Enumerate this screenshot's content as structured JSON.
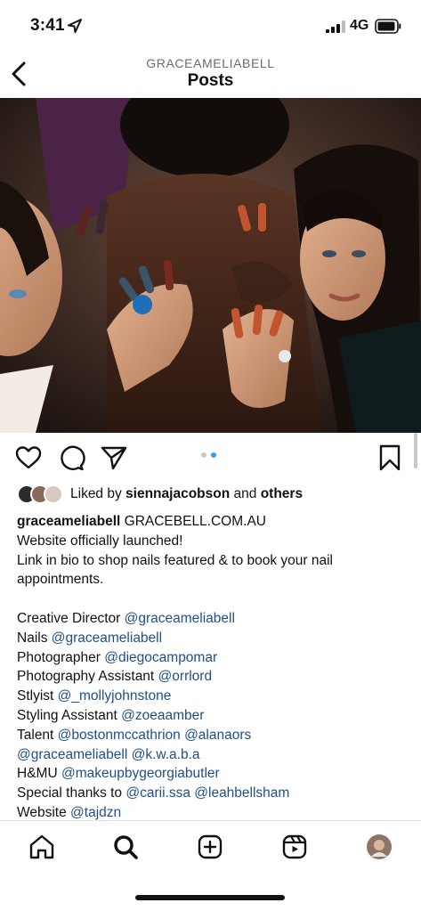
{
  "status_bar": {
    "time": "3:41",
    "network": "4G",
    "icons": [
      "location-arrow-icon",
      "signal-bars-icon",
      "battery-icon"
    ]
  },
  "header": {
    "username": "GRACEAMELIABELL",
    "title": "Posts",
    "back_icon": "chevron-left-icon"
  },
  "post": {
    "image_icon": "photo",
    "actions": [
      "heart-icon",
      "comment-icon",
      "share-icon",
      "bookmark-icon"
    ],
    "carousel": {
      "count": 2,
      "active": 2
    },
    "likes": {
      "prefix": "Liked by",
      "user": "siennajacobson",
      "and": "and",
      "others": "others"
    },
    "caption": {
      "username": "graceameliabell",
      "first_line": "GRACEBELL.COM.AU",
      "lines": [
        "Website officially launched!",
        "Link in bio to shop nails featured & to book your nail",
        "appointments."
      ],
      "credits": [
        {
          "label": "Creative Director ",
          "mentions": [
            "@graceameliabell"
          ]
        },
        {
          "label": "Nails ",
          "mentions": [
            "@graceameliabell"
          ]
        },
        {
          "label": "Photographer ",
          "mentions": [
            "@diegocampomar"
          ]
        },
        {
          "label": "Photography Assistant ",
          "mentions": [
            "@orrlord"
          ]
        },
        {
          "label": "Stlyist ",
          "mentions": [
            "@_mollyjohnstone"
          ]
        },
        {
          "label": "Styling Assistant ",
          "mentions": [
            "@zoeaamber"
          ]
        },
        {
          "label": "Talent ",
          "mentions": [
            "@bostonmccathrion",
            "@alanaors"
          ]
        },
        {
          "label": "",
          "mentions": [
            "@graceameliabell",
            "@k.w.a.b.a"
          ]
        },
        {
          "label": "H&MU ",
          "mentions": [
            "@makeupbygeorgiabutler"
          ]
        },
        {
          "label": "Special thanks to ",
          "mentions": [
            "@carii.ssa",
            "@leahbellsham"
          ]
        },
        {
          "label": "Website ",
          "mentions": [
            "@tajdzn"
          ]
        }
      ]
    }
  },
  "tabbar": {
    "items": [
      "home-icon",
      "search-icon",
      "create-icon",
      "reels-icon",
      "profile-avatar"
    ]
  },
  "colors": {
    "mention": "#1f4f86",
    "carousel_active": "#3897f0",
    "header_username": "#6b6b6b"
  }
}
